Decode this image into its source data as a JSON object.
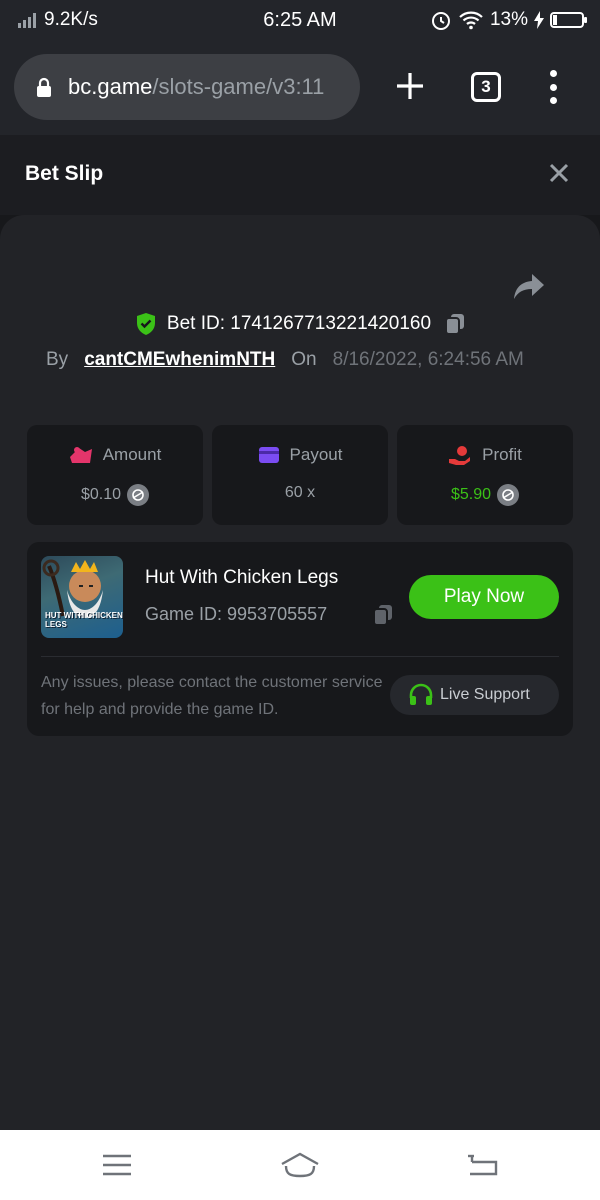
{
  "status_bar": {
    "net_speed": "9.2K/s",
    "time": "6:25 AM",
    "battery": "13%"
  },
  "browser": {
    "url_domain": "bc.game",
    "url_path": "/slots-game/v3:11",
    "tab_count": "3"
  },
  "modal": {
    "title": "Bet Slip"
  },
  "bet": {
    "id_label": "Bet ID: 1741267713221420160",
    "by_label": "By",
    "user": "cantCMEwhenimNTH",
    "on_label": "On",
    "date": "8/16/2022, 6:24:56 AM"
  },
  "stats": [
    {
      "label": "Amount",
      "value": "$0.10",
      "icon": "amount-icon",
      "color": "#e4356b"
    },
    {
      "label": "Payout",
      "value": "60 x",
      "icon": "payout-icon",
      "color": "#7b4cf2"
    },
    {
      "label": "Profit",
      "value": "$5.90",
      "icon": "profit-icon",
      "color": "#e53a3a"
    }
  ],
  "game": {
    "name": "Hut With Chicken Legs",
    "id_label": "Game ID: 9953705557",
    "thumb_text": "HUT WITH CHICKEN LEGS",
    "play_label": "Play Now",
    "issues_text": "Any issues, please contact the customer service for help and provide the game ID.",
    "support_label": "Live Support"
  },
  "colors": {
    "accent_green": "#3bc117",
    "background": "#17181b",
    "card": "#222327"
  }
}
